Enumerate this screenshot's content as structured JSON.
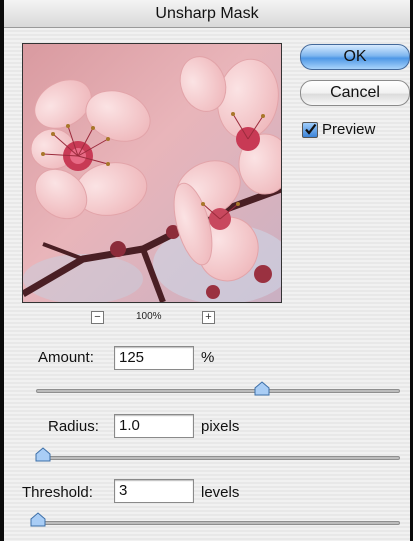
{
  "dialog": {
    "title": "Unsharp Mask"
  },
  "buttons": {
    "ok": "OK",
    "cancel": "Cancel"
  },
  "preview_option": {
    "label": "Preview",
    "checked": true
  },
  "zoom": {
    "minus": "−",
    "level": "100%",
    "plus": "+"
  },
  "fields": {
    "amount": {
      "label": "Amount:",
      "value": "125",
      "unit": "%",
      "slider_fraction": 0.62
    },
    "radius": {
      "label": "Radius:",
      "value": "1.0",
      "unit": "pixels",
      "slider_fraction": 0.02
    },
    "threshold": {
      "label": "Threshold:",
      "value": "3",
      "unit": "levels",
      "slider_fraction": 0.01
    }
  },
  "colors": {
    "accent": "#4e97e6",
    "blossom": "#f3c7c9",
    "blossom_center": "#c83a55"
  },
  "icons": {
    "check": "checkmark-icon",
    "slider_thumb": "slider-thumb-icon"
  }
}
